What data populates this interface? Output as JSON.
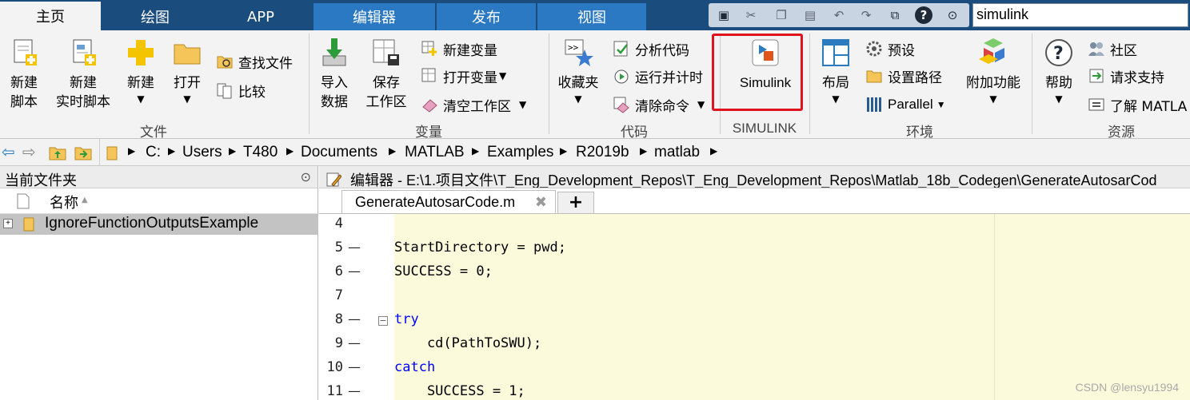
{
  "tabs": [
    "主页",
    "绘图",
    "APP",
    "编辑器",
    "发布",
    "视图"
  ],
  "search": {
    "value": "simulink"
  },
  "ribbon": {
    "groups": [
      "文件",
      "变量",
      "代码",
      "SIMULINK",
      "环境",
      "资源"
    ],
    "file": {
      "new_script_1": "新建",
      "new_script_2": "脚本",
      "new_live_1": "新建",
      "new_live_2": "实时脚本",
      "new": "新建",
      "open": "打开",
      "find_files": "查找文件",
      "compare": "比较"
    },
    "variable": {
      "import_1": "导入",
      "import_2": "数据",
      "save_1": "保存",
      "save_2": "工作区",
      "new_var": "新建变量",
      "open_var": "打开变量",
      "clear_ws": "清空工作区"
    },
    "code": {
      "favorites": "收藏夹",
      "analyze": "分析代码",
      "run_time": "运行并计时",
      "clear_cmd": "清除命令"
    },
    "simulink": {
      "button": "Simulink"
    },
    "env": {
      "layout": "布局",
      "prefs": "预设",
      "set_path": "设置路径",
      "parallel": "Parallel",
      "addons": "附加功能"
    },
    "resources": {
      "help": "帮助",
      "community": "社区",
      "request_support": "请求支持",
      "learn": "了解 MATLA"
    }
  },
  "address": [
    "C:",
    "Users",
    "T480",
    "Documents",
    "MATLAB",
    "Examples",
    "R2019b",
    "matlab"
  ],
  "current_folder": {
    "title": "当前文件夹",
    "col_name": "名称",
    "rows": [
      "IgnoreFunctionOutputsExample"
    ]
  },
  "editor": {
    "title": "编辑器 - E:\\1.项目文件\\T_Eng_Development_Repos\\T_Eng_Development_Repos\\Matlab_18b_Codegen\\GenerateAutosarCod",
    "file_tab": "GenerateAutosarCode.m",
    "plus": "+",
    "lines": [
      {
        "n": "4",
        "dash": "",
        "code": ""
      },
      {
        "n": "5",
        "dash": "—",
        "code": "StartDirectory = pwd;"
      },
      {
        "n": "6",
        "dash": "—",
        "code": "SUCCESS = 0;"
      },
      {
        "n": "7",
        "dash": "",
        "code": ""
      },
      {
        "n": "8",
        "dash": "—",
        "code": "try"
      },
      {
        "n": "9",
        "dash": "—",
        "code": "    cd(PathToSWU);"
      },
      {
        "n": "10",
        "dash": "—",
        "code": "catch"
      },
      {
        "n": "11",
        "dash": "—",
        "code": "    SUCCESS = 1;"
      }
    ]
  },
  "watermark": "CSDN @lensyu1994",
  "colors": {
    "tabbar": "#1a4d7e",
    "ribbon": "#f3f3f3",
    "highlight": "#e0121b",
    "code_bg": "#fbfbdc",
    "keyword": "#0000ff"
  }
}
